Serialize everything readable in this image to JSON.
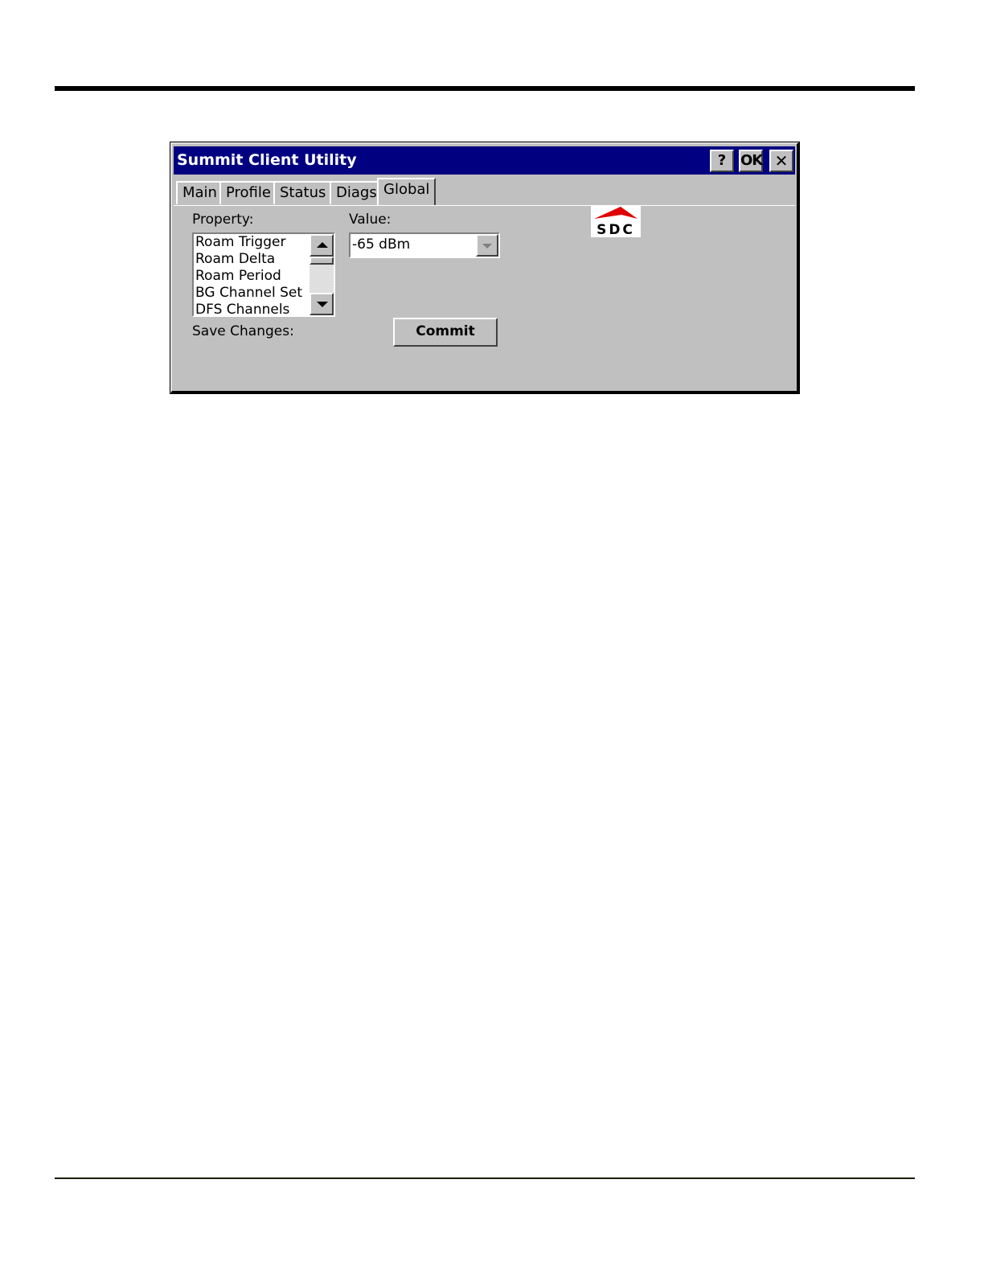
{
  "window": {
    "title": "Summit Client Utility",
    "help_label": "?",
    "ok_label": "OK",
    "close_label": "✕"
  },
  "tabs": [
    {
      "label": "Main"
    },
    {
      "label": "Profile"
    },
    {
      "label": "Status"
    },
    {
      "label": "Diags"
    },
    {
      "label": "Global",
      "active": true
    }
  ],
  "global": {
    "property_label": "Property:",
    "value_label": "Value:",
    "properties": [
      "Roam Trigger",
      "Roam Delta",
      "Roam Period",
      "BG Channel Set",
      "DFS Channels"
    ],
    "selected_value": "-65 dBm",
    "save_changes_label": "Save Changes:",
    "commit_label": "Commit"
  },
  "logo": {
    "text": "SDC",
    "color": "#e00000"
  },
  "colors": {
    "titlebar": "#000080",
    "window_face": "#c0c0c0"
  }
}
